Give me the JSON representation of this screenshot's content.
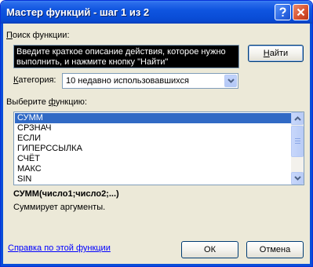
{
  "window": {
    "title": "Мастер функций - шаг 1 из 2",
    "help_icon": "help-icon",
    "close_icon": "close-icon"
  },
  "search": {
    "label_prefix": "",
    "label_hotkey": "П",
    "label_rest": "оиск функции:",
    "text_line1": "Введите краткое описание действия, которое нужно",
    "text_line2": "выполнить, и нажмите кнопку \"Найти\"",
    "button_prefix": "",
    "button_hotkey": "Н",
    "button_rest": "айти"
  },
  "category": {
    "label_prefix": "",
    "label_hotkey": "К",
    "label_rest": "атегория:",
    "value": "10 недавно использовавшихся"
  },
  "function_list": {
    "label_prefix": "Выберите ",
    "label_hotkey": "ф",
    "label_rest": "ункцию:",
    "items": [
      "СУММ",
      "СРЗНАЧ",
      "ЕСЛИ",
      "ГИПЕРССЫЛКА",
      "СЧЁТ",
      "МАКС",
      "SIN"
    ],
    "selected_index": 0
  },
  "details": {
    "signature": "СУММ(число1;число2;...)",
    "description": "Суммирует аргументы."
  },
  "footer": {
    "help_link": "Справка по этой функции",
    "ok_label": "ОК",
    "cancel_label": "Отмена"
  },
  "colors": {
    "selection": "#316AC5",
    "titlebar": "#0A4ED8",
    "dialog_bg": "#ECE9D8",
    "link": "#0000FF"
  }
}
